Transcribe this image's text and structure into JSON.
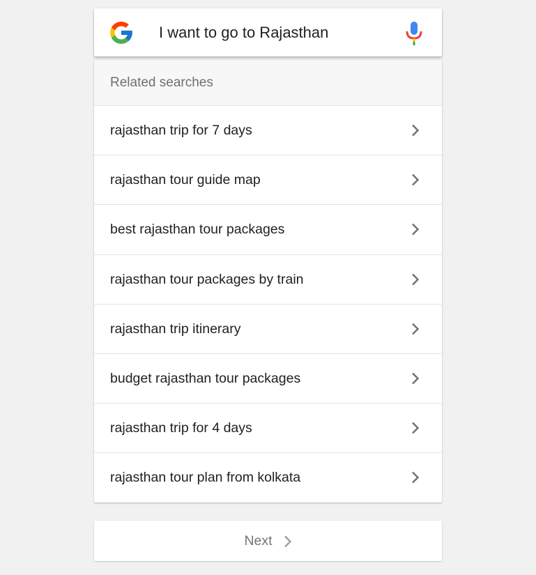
{
  "search": {
    "query": "I want to go to Rajasthan",
    "logo_icon": "google-g-logo",
    "mic_icon": "microphone-icon"
  },
  "related": {
    "header": "Related searches",
    "items": [
      {
        "label": "rajasthan trip for 7 days"
      },
      {
        "label": "rajasthan tour guide map"
      },
      {
        "label": "best rajasthan tour packages"
      },
      {
        "label": "rajasthan tour packages by train"
      },
      {
        "label": "rajasthan trip itinerary"
      },
      {
        "label": "budget rajasthan tour packages"
      },
      {
        "label": "rajasthan trip for 4 days"
      },
      {
        "label": "rajasthan tour plan from kolkata"
      }
    ]
  },
  "pagination": {
    "next_label": "Next"
  },
  "colors": {
    "background": "#f1f1f1",
    "google_blue": "#4285F4",
    "google_red": "#EA4335",
    "google_yellow": "#FBBC05",
    "google_green": "#34A853"
  }
}
